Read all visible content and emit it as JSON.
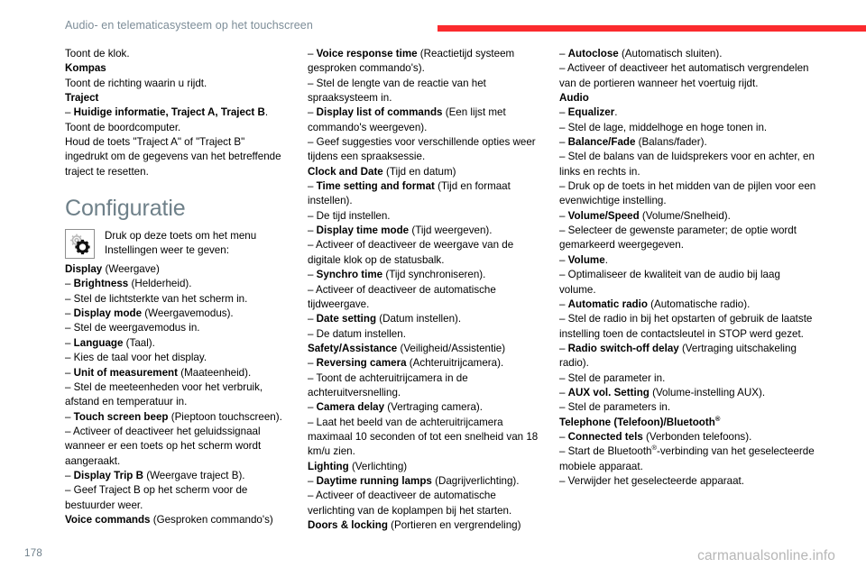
{
  "header": {
    "title": "Audio- en telematicasysteem op het touchscreen",
    "rule_color": "#fb2b2e"
  },
  "footer": {
    "page_number": "178",
    "watermark": "carmanualsonline.info"
  },
  "section": {
    "heading": "Configuratie",
    "icon_name": "gears-settings-icon",
    "icon_caption_line1": "Druk op deze toets om het menu",
    "icon_caption_line2": "Instellingen weer te geven:"
  },
  "columns": {
    "left": [
      {
        "plain": "Toont de klok."
      },
      {
        "bold": "Kompas"
      },
      {
        "plain": "Toont de richting waarin u rijdt."
      },
      {
        "bold": "Traject"
      },
      {
        "dash": "– ",
        "bold": "Huidige informatie, Traject A, Traject B",
        "plain": "."
      },
      {
        "plain": "Toont de boordcomputer."
      },
      {
        "plain": "Houd de toets \"Traject A\" of \"Traject B\" ingedrukt om de gegevens van het betreffende traject te resetten."
      }
    ],
    "left_after_icon": [
      {
        "bold": "Display",
        "plain": " (Weergave)"
      },
      {
        "dash": "– ",
        "bold": "Brightness",
        "plain": " (Helderheid)."
      },
      {
        "dash": "– ",
        "plain": "Stel de lichtsterkte van het scherm in."
      },
      {
        "dash": "– ",
        "bold": "Display mode",
        "plain": " (Weergavemodus)."
      },
      {
        "dash": "– ",
        "plain": "Stel de weergavemodus in."
      },
      {
        "dash": "– ",
        "bold": "Language",
        "plain": " (Taal)."
      },
      {
        "dash": "– ",
        "plain": "Kies de taal voor het display."
      },
      {
        "dash": "– ",
        "bold": "Unit of measurement",
        "plain": " (Maateenheid)."
      },
      {
        "dash": "– ",
        "plain": "Stel de meeteenheden voor het verbruik, afstand en temperatuur in."
      },
      {
        "dash": "– ",
        "bold": "Touch screen beep",
        "plain": " (Pieptoon touchscreen)."
      },
      {
        "dash": "– ",
        "plain": "Activeer of deactiveer het geluidssignaal wanneer er een toets op het scherm wordt aangeraakt."
      },
      {
        "dash": "– ",
        "bold": "Display Trip B",
        "plain": " (Weergave traject B)."
      },
      {
        "dash": "– ",
        "plain": "Geef Traject B op het scherm voor de bestuurder weer."
      },
      {
        "bold": "Voice commands",
        "plain": " (Gesproken commando's)"
      }
    ],
    "middle": [
      {
        "dash": "– ",
        "bold": "Voice response time",
        "plain": " (Reactietijd systeem gesproken commando's)."
      },
      {
        "dash": "– ",
        "plain": "Stel de lengte van de reactie van het spraaksysteem in."
      },
      {
        "dash": "– ",
        "bold": "Display list of commands",
        "plain": " (Een lijst met commando's weergeven)."
      },
      {
        "dash": "– ",
        "plain": "Geef suggesties voor verschillende opties weer tijdens een spraaksessie."
      },
      {
        "bold": "Clock and Date",
        "plain": " (Tijd en datum)"
      },
      {
        "dash": "– ",
        "bold": "Time setting and format",
        "plain": " (Tijd en formaat instellen)."
      },
      {
        "dash": "– ",
        "plain": "De tijd instellen."
      },
      {
        "dash": "– ",
        "bold": "Display time mode",
        "plain": " (Tijd weergeven)."
      },
      {
        "dash": "– ",
        "plain": "Activeer of deactiveer de weergave van de digitale klok op de statusbalk."
      },
      {
        "dash": "– ",
        "bold": "Synchro time",
        "plain": " (Tijd synchroniseren)."
      },
      {
        "dash": "– ",
        "plain": "Activeer of deactiveer de automatische tijdweergave."
      },
      {
        "dash": "– ",
        "bold": "Date setting",
        "plain": " (Datum instellen)."
      },
      {
        "dash": "– ",
        "plain": "De datum instellen."
      },
      {
        "bold": "Safety/Assistance",
        "plain": " (Veiligheid/Assistentie)"
      },
      {
        "dash": "– ",
        "bold": "Reversing camera",
        "plain": " (Achteruitrijcamera)."
      },
      {
        "dash": "– ",
        "plain": "Toont de achteruitrijcamera in de achteruitversnelling."
      },
      {
        "dash": "– ",
        "bold": "Camera delay",
        "plain": " (Vertraging camera)."
      },
      {
        "dash": "– ",
        "plain": "Laat het beeld van de achteruitrijcamera maximaal 10 seconden of tot een snelheid van 18 km/u zien."
      },
      {
        "bold": "Lighting",
        "plain": " (Verlichting)"
      },
      {
        "dash": "– ",
        "bold": "Daytime running lamps",
        "plain": " (Dagrijverlichting)."
      },
      {
        "dash": "– ",
        "plain": "Activeer of deactiveer de automatische verlichting van de koplampen bij het starten."
      },
      {
        "bold": "Doors & locking",
        "plain": " (Portieren en vergrendeling)"
      }
    ],
    "right": [
      {
        "dash": "– ",
        "bold": "Autoclose",
        "plain": " (Automatisch sluiten)."
      },
      {
        "dash": "– ",
        "plain": "Activeer of deactiveer het automatisch vergrendelen van de portieren wanneer het voertuig rijdt."
      },
      {
        "bold": "Audio"
      },
      {
        "dash": "– ",
        "bold": "Equalizer",
        "plain": "."
      },
      {
        "dash": "– ",
        "plain": "Stel de lage, middelhoge en hoge tonen in."
      },
      {
        "dash": "– ",
        "bold": "Balance/Fade",
        "plain": " (Balans/fader)."
      },
      {
        "dash": "– ",
        "plain": "Stel de balans van de luidsprekers voor en achter, en links en rechts in."
      },
      {
        "dash": "– ",
        "plain": "Druk op de toets in het midden van de pijlen voor een evenwichtige instelling."
      },
      {
        "dash": "– ",
        "bold": "Volume/Speed",
        "plain": " (Volume/Snelheid)."
      },
      {
        "dash": "– ",
        "plain": "Selecteer de gewenste parameter; de optie wordt gemarkeerd weergegeven."
      },
      {
        "dash": "– ",
        "bold": "Volume",
        "plain": "."
      },
      {
        "dash": "– ",
        "plain": "Optimaliseer de kwaliteit van de audio bij laag volume."
      },
      {
        "dash": "– ",
        "bold": "Automatic radio",
        "plain": " (Automatische radio)."
      },
      {
        "dash": "– ",
        "plain": "Stel de radio in bij het opstarten of gebruik de laatste instelling toen de contactsleutel in STOP werd gezet."
      },
      {
        "dash": "– ",
        "bold": "Radio switch-off delay",
        "plain": " (Vertraging uitschakeling radio)."
      },
      {
        "dash": "– ",
        "plain": "Stel de parameter in."
      },
      {
        "dash": "– ",
        "bold": "AUX vol. Setting",
        "plain": " (Volume-instelling AUX)."
      },
      {
        "dash": "– ",
        "plain": "Stel de parameters in."
      },
      {
        "bold": "Telephone (Telefoon)/Bluetooth",
        "sup": "®"
      },
      {
        "dash": "– ",
        "bold": "Connected tels",
        "plain": " (Verbonden telefoons)."
      },
      {
        "dash": "– ",
        "plain": "Start de Bluetooth",
        "sup_mid": "®",
        "plain2": "-verbinding van het geselecteerde mobiele apparaat."
      },
      {
        "dash": "– ",
        "plain": "Verwijder het geselecteerde apparaat."
      }
    ]
  }
}
